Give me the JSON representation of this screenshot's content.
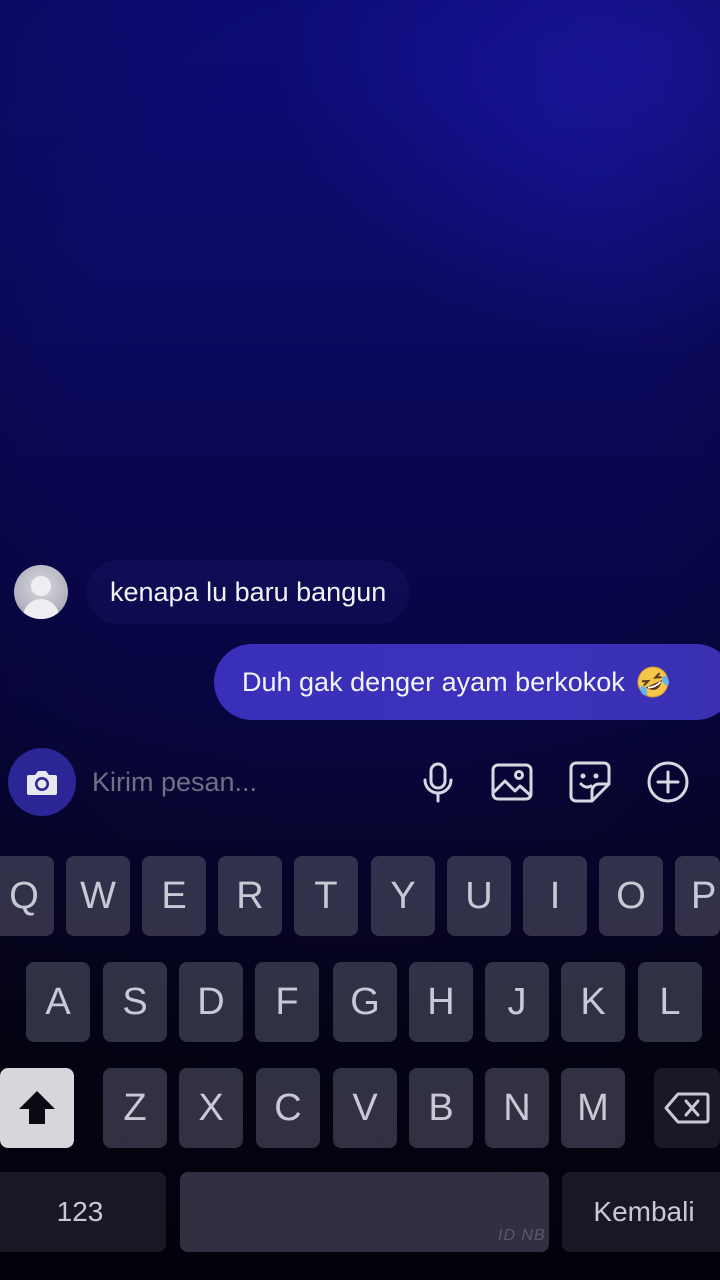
{
  "chat": {
    "incoming_message": "kenapa lu baru bangun",
    "outgoing_message": "Duh gak denger ayam berkokok",
    "outgoing_emoji": "rolling-on-the-floor-laughing-emoji"
  },
  "composer": {
    "placeholder": "Kirim pesan...",
    "icons": [
      "camera-icon",
      "microphone-icon",
      "image-icon",
      "sticker-icon",
      "plus-circle-icon"
    ]
  },
  "keyboard": {
    "row1": [
      "Q",
      "W",
      "E",
      "R",
      "T",
      "Y",
      "U",
      "I",
      "O",
      "P"
    ],
    "row2": [
      "A",
      "S",
      "D",
      "F",
      "G",
      "H",
      "J",
      "K",
      "L"
    ],
    "row3": [
      "Z",
      "X",
      "C",
      "V",
      "B",
      "N",
      "M"
    ],
    "numbers_key": "123",
    "return_key": "Kembali",
    "watermark": "ID NB"
  },
  "colors": {
    "accent": "#3a2fb8",
    "camera_button": "#2b2596",
    "background_top": "#0d0b78",
    "background_bottom": "#040311"
  }
}
